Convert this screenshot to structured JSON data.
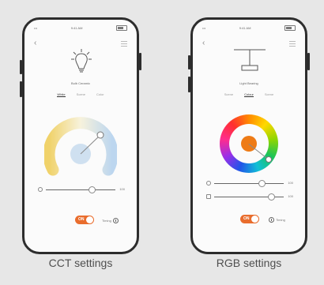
{
  "cct_screen": {
    "status_time": "9:41 AM",
    "device_name": "Bulb Ceramic",
    "tabs": [
      "White",
      "Scene",
      "Color"
    ],
    "active_tab_index": 0,
    "brightness_value": 0.67,
    "slider_end_label": "100",
    "toggle_label": "ON",
    "timer_label": "Timing",
    "caption": "CCT settings"
  },
  "rgb_screen": {
    "status_time": "9:41 AM",
    "device_name": "Light Bearing",
    "tabs": [
      "Scene",
      "Colour",
      "Scene"
    ],
    "active_tab_index": 1,
    "brightness_value": 0.69,
    "saturation_value": 0.82,
    "slider1_end_label": "100",
    "slider2_end_label": "100",
    "toggle_label": "ON",
    "timer_label": "Timing",
    "caption": "RGB settings"
  },
  "colors": {
    "accent": "#E96D2D",
    "device_frame": "#2D2D2D",
    "background": "#E7E7E7"
  }
}
